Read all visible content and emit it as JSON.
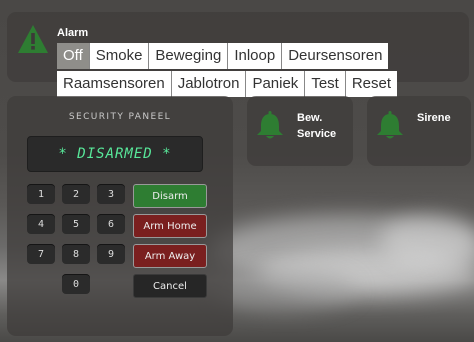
{
  "colors": {
    "accent_green": "#2e7d32",
    "accent_red": "#7a1f1f",
    "lcd_text": "#58e89a",
    "icon_green": "#2e7d32"
  },
  "alarm": {
    "icon": "warning-triangle-icon",
    "title": "Alarm",
    "selected": "Off",
    "options_row1": [
      "Off",
      "Smoke",
      "Beweging",
      "Inloop",
      "Deursensoren"
    ],
    "options_row2": [
      "Raamsensoren",
      "Jablotron",
      "Paniek",
      "Test",
      "Reset"
    ]
  },
  "panel": {
    "title": "SECURITY PANEEL",
    "display": "* DISARMED *",
    "keys": [
      "1",
      "2",
      "3",
      "4",
      "5",
      "6",
      "7",
      "8",
      "9",
      "0"
    ],
    "disarm": "Disarm",
    "arm_home": "Arm Home",
    "arm_away": "Arm Away",
    "cancel": "Cancel"
  },
  "service": {
    "icon": "bell-icon",
    "label_line1": "Bew.",
    "label_line2": "Service"
  },
  "sirene": {
    "icon": "bell-icon",
    "label": "Sirene"
  }
}
